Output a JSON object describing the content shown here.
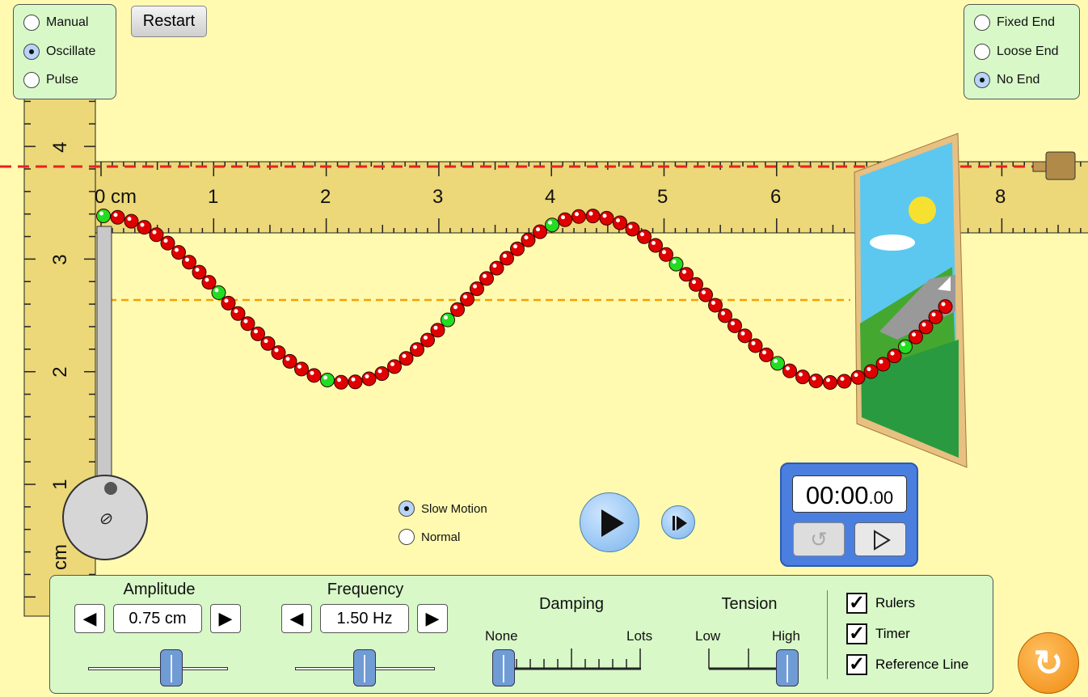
{
  "mode_options": [
    {
      "label": "Manual",
      "selected": false
    },
    {
      "label": "Oscillate",
      "selected": true
    },
    {
      "label": "Pulse",
      "selected": false
    }
  ],
  "restart_label": "Restart",
  "end_options": [
    {
      "label": "Fixed End",
      "selected": false
    },
    {
      "label": "Loose End",
      "selected": false
    },
    {
      "label": "No End",
      "selected": true
    }
  ],
  "horizontal_ruler": {
    "labels": [
      "0 cm",
      "1",
      "2",
      "3",
      "4",
      "5",
      "6",
      "8"
    ]
  },
  "vertical_ruler": {
    "labels": [
      "4",
      "3",
      "2",
      "1",
      "cm"
    ]
  },
  "speed_options": [
    {
      "label": "Slow Motion",
      "selected": true
    },
    {
      "label": "Normal",
      "selected": false
    }
  ],
  "timer": {
    "main": "00:00",
    "fraction": ".00"
  },
  "controls": {
    "amplitude": {
      "label": "Amplitude",
      "value": "0.75 cm",
      "level": 0.5
    },
    "frequency": {
      "label": "Frequency",
      "value": "1.50 Hz",
      "level": 0.5
    },
    "damping": {
      "label": "Damping",
      "min": "None",
      "max": "Lots",
      "level": 0
    },
    "tension": {
      "label": "Tension",
      "min": "Low",
      "max": "High",
      "level": 1
    }
  },
  "checkboxes": [
    {
      "label": "Rulers",
      "checked": true
    },
    {
      "label": "Timer",
      "checked": true
    },
    {
      "label": "Reference Line",
      "checked": true
    }
  ],
  "colors": {
    "background": "#fffab0",
    "panel": "#d8f8c8",
    "bead": "#e00000",
    "bead_marker": "#22dd22",
    "reference_line": "#e82020",
    "equilibrium_line": "#f5a000",
    "timer": "#4a7fe0",
    "reset": "#f08a10"
  }
}
